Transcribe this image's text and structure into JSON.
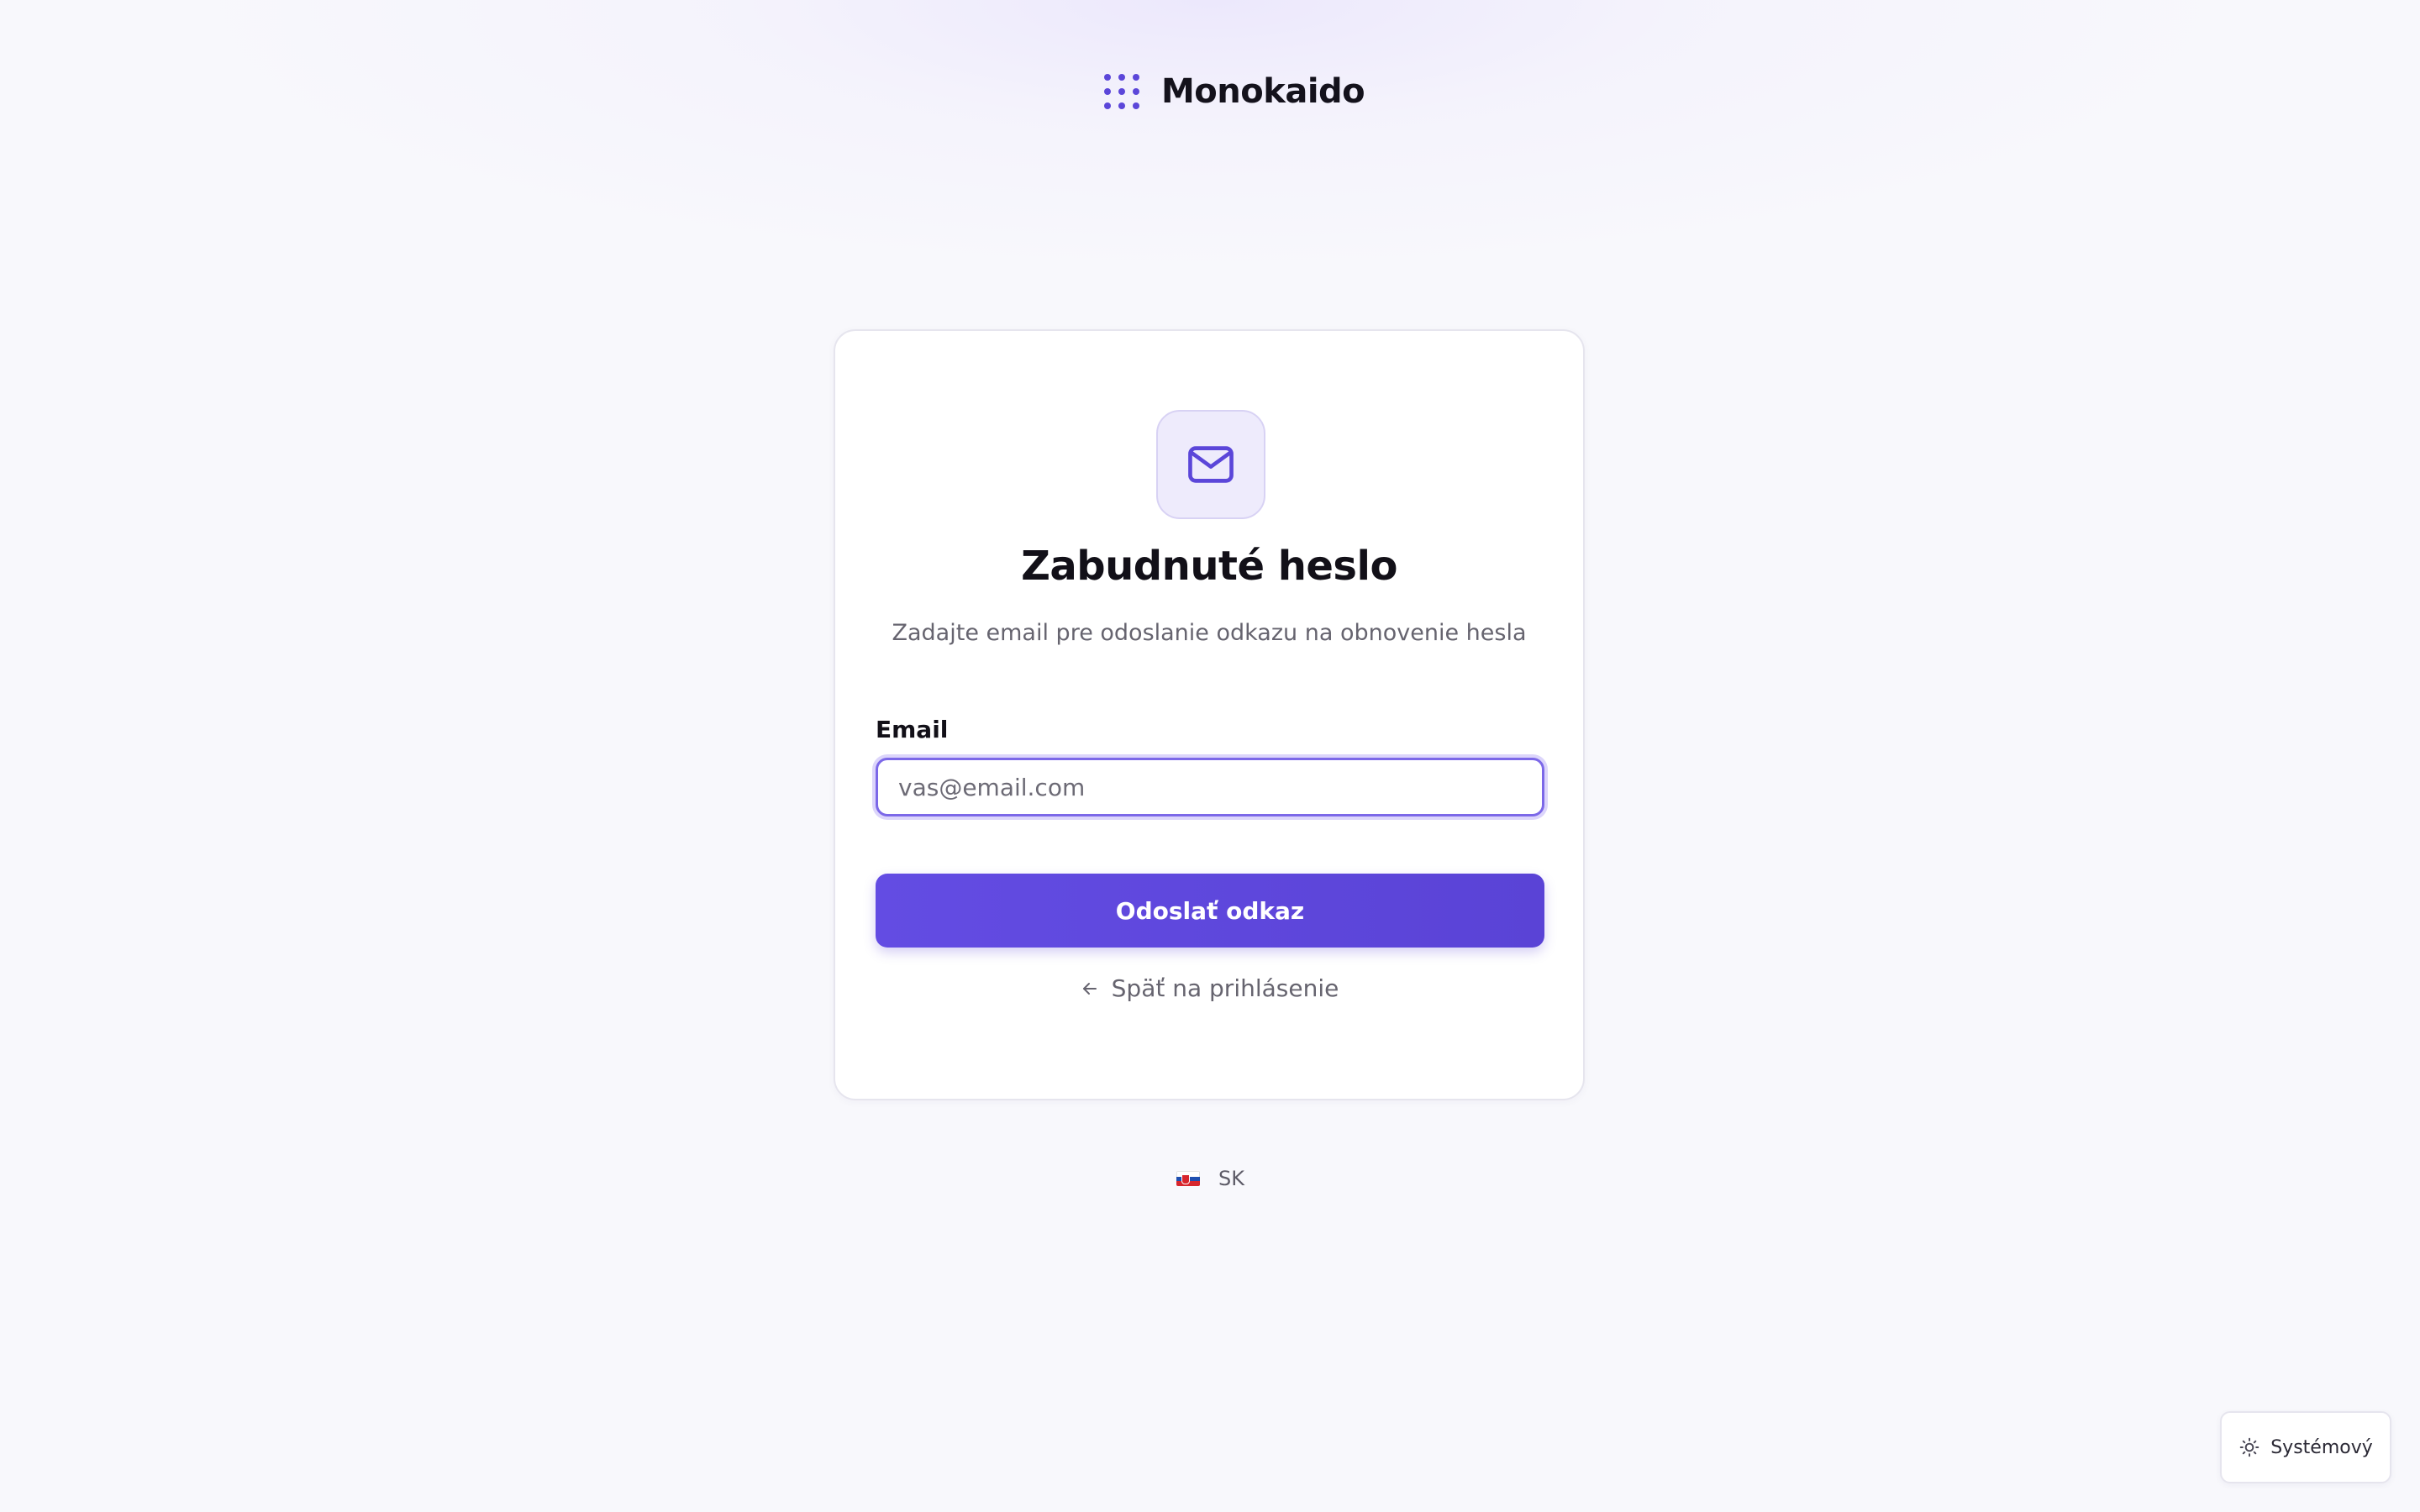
{
  "brand": {
    "name": "Monokaido",
    "logo_icon": "dot-grid-icon",
    "accent_color": "#5b46d9"
  },
  "card": {
    "icon": "mail-icon",
    "title": "Zabudnuté heslo",
    "subtitle": "Zadajte email pre odoslanie odkazu na obnovenie hesla",
    "email": {
      "label": "Email",
      "placeholder": "vas@email.com",
      "value": ""
    },
    "submit_label": "Odoslať odkaz",
    "back_link": {
      "icon": "arrow-left-icon",
      "label": "Späť na prihlásenie"
    }
  },
  "language": {
    "flag": "slovakia-flag-icon",
    "code": "SK"
  },
  "theme": {
    "icon": "sun-icon",
    "label": "Systémový"
  },
  "colors": {
    "primary": "#5b46d9",
    "background": "#f8f8fc",
    "text": "#121018",
    "muted_text": "#66646f"
  }
}
